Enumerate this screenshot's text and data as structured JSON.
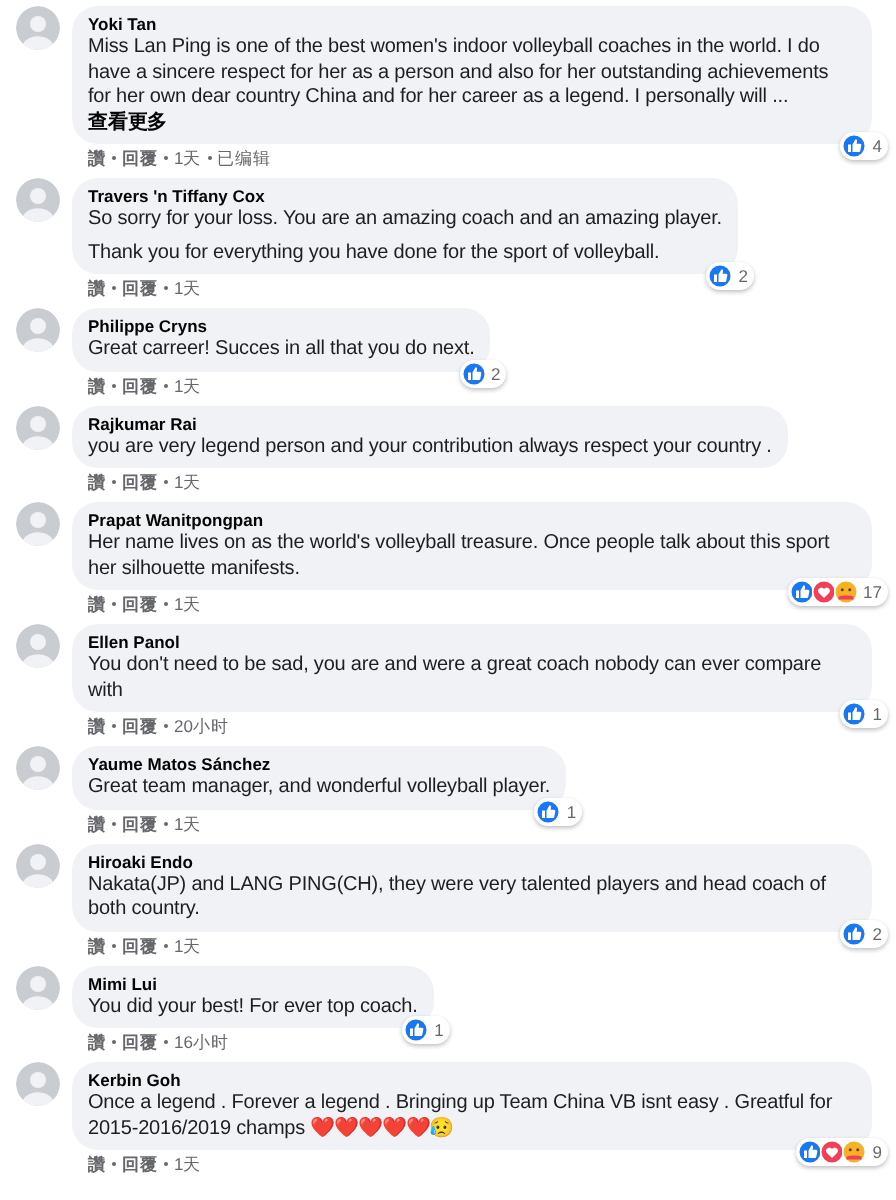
{
  "comments": [
    {
      "name": "Yoki Tan",
      "paragraphs": [
        "Miss Lan Ping is one of the best women's indoor volleyball coaches in the world. I do have a sincere respect for her as a person and also for her outstanding achievements for her own dear country China and for her career as a legend. I personally will ..."
      ],
      "see_more": "查看更多",
      "like": "讚",
      "reply": "回覆",
      "time": "1天",
      "edited": "已编辑",
      "reactions": [
        {
          "kind": "like"
        }
      ],
      "reaction_count": "4"
    },
    {
      "name": "Travers 'n Tiffany Cox",
      "paragraphs": [
        "So sorry for your loss. You are an amazing coach and an amazing player.",
        "Thank you for everything you have done for the sport of volleyball."
      ],
      "like": "讚",
      "reply": "回覆",
      "time": "1天",
      "reactions": [
        {
          "kind": "like"
        }
      ],
      "reaction_count": "2"
    },
    {
      "name": "Philippe Cryns",
      "paragraphs": [
        "Great carreer! Succes in all that you do next."
      ],
      "like": "讚",
      "reply": "回覆",
      "time": "1天",
      "reactions": [
        {
          "kind": "like"
        }
      ],
      "reaction_count": "2"
    },
    {
      "name": "Rajkumar Rai",
      "paragraphs": [
        "you are very legend person and your contribution always respect your country ."
      ],
      "like": "讚",
      "reply": "回覆",
      "time": "1天"
    },
    {
      "name": "Prapat Wanitpongpan",
      "paragraphs": [
        "Her name lives on as the world's volleyball treasure. Once people talk about this sport her silhouette manifests."
      ],
      "like": "讚",
      "reply": "回覆",
      "time": "1天",
      "reactions": [
        {
          "kind": "like"
        },
        {
          "kind": "love"
        },
        {
          "kind": "care"
        }
      ],
      "reaction_count": "17"
    },
    {
      "name": "Ellen Panol",
      "paragraphs": [
        "You don't need to be sad, you are and were a great coach nobody can ever compare with"
      ],
      "like": "讚",
      "reply": "回覆",
      "time": "20小时",
      "reactions": [
        {
          "kind": "like"
        }
      ],
      "reaction_count": "1"
    },
    {
      "name": "Yaume Matos Sánchez",
      "paragraphs": [
        "Great team manager, and wonderful volleyball player."
      ],
      "like": "讚",
      "reply": "回覆",
      "time": "1天",
      "reactions": [
        {
          "kind": "like"
        }
      ],
      "reaction_count": "1"
    },
    {
      "name": "Hiroaki Endo",
      "paragraphs": [
        "Nakata(JP) and LANG PING(CH), they were very talented players and head coach of both country."
      ],
      "like": "讚",
      "reply": "回覆",
      "time": "1天",
      "reactions": [
        {
          "kind": "like"
        }
      ],
      "reaction_count": "2"
    },
    {
      "name": "Mimi Lui",
      "paragraphs": [
        "You did your best! For ever top coach."
      ],
      "like": "讚",
      "reply": "回覆",
      "time": "16小时",
      "reactions": [
        {
          "kind": "like"
        }
      ],
      "reaction_count": "1"
    },
    {
      "name": "Kerbin Goh",
      "paragraphs": [
        "Once a legend . Forever a legend . Bringing up Team China VB isnt easy . Greatful for 2015-2016/2019 champs ❤️❤️❤️❤️❤️😥"
      ],
      "like": "讚",
      "reply": "回覆",
      "time": "1天",
      "reactions": [
        {
          "kind": "like"
        },
        {
          "kind": "love"
        },
        {
          "kind": "care"
        }
      ],
      "reaction_count": "9"
    }
  ]
}
